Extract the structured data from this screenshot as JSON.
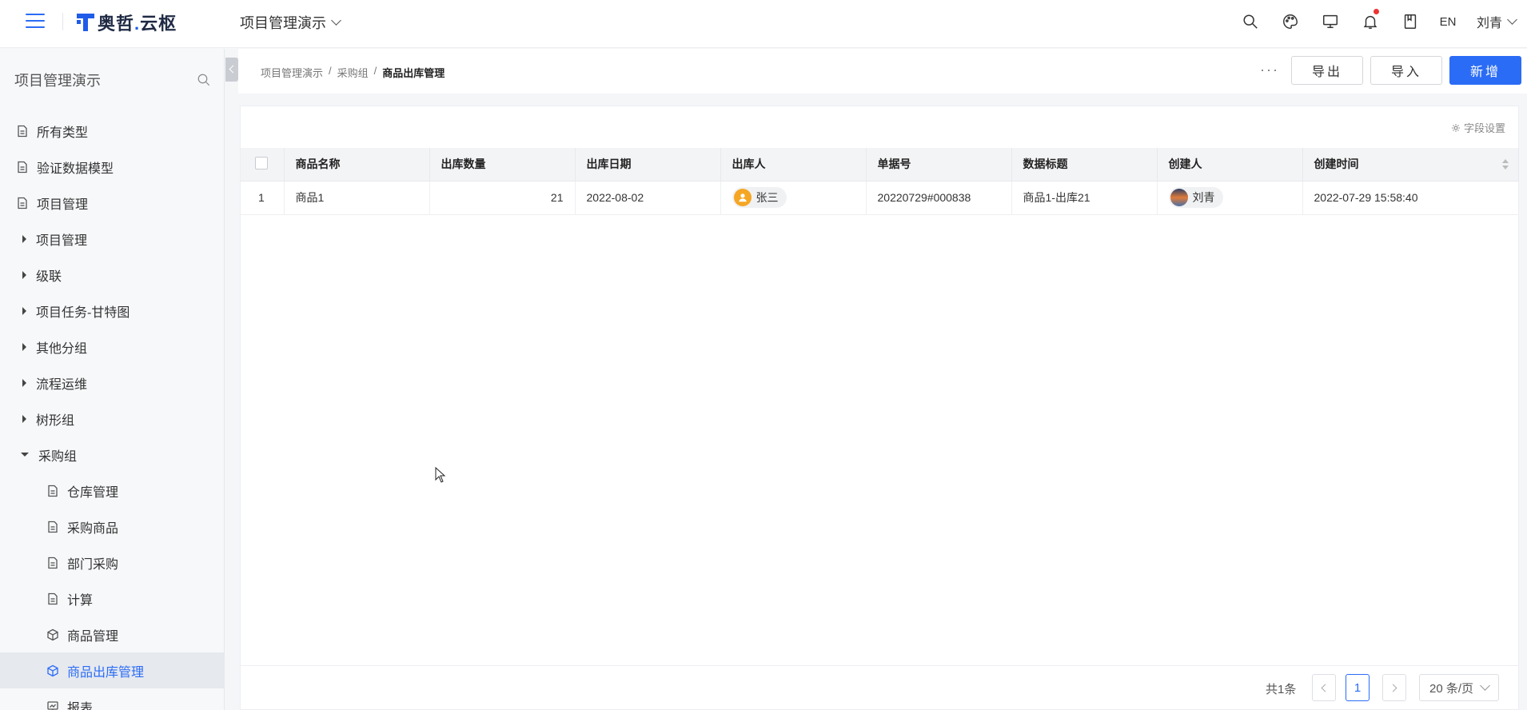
{
  "app": {
    "logo_text_a": "奥哲",
    "logo_dot": ".",
    "logo_text_b": "云枢",
    "project_name": "项目管理演示",
    "lang": "EN",
    "user_name": "刘青"
  },
  "sidebar": {
    "title": "项目管理演示",
    "items": [
      {
        "label": "所有类型"
      },
      {
        "label": "验证数据模型"
      },
      {
        "label": "项目管理"
      },
      {
        "label": "项目管理"
      },
      {
        "label": "级联"
      },
      {
        "label": "项目任务-甘特图"
      },
      {
        "label": "其他分组"
      },
      {
        "label": "流程运维"
      },
      {
        "label": "树形组"
      },
      {
        "label": "采购组"
      },
      {
        "label": "仓库管理"
      },
      {
        "label": "采购商品"
      },
      {
        "label": "部门采购"
      },
      {
        "label": "计算"
      },
      {
        "label": "商品管理"
      },
      {
        "label": "商品出库管理"
      },
      {
        "label": "报表"
      }
    ]
  },
  "breadcrumb": [
    "项目管理演示",
    "/",
    "采购组",
    "/",
    "商品出库管理"
  ],
  "toolbar": {
    "more": "···",
    "export_label": "导出",
    "import_label": "导入",
    "add_label": "新增",
    "field_settings": "字段设置"
  },
  "table": {
    "headers": [
      "商品名称",
      "出库数量",
      "出库日期",
      "出库人",
      "单据号",
      "数据标题",
      "创建人",
      "创建时间"
    ],
    "rows": [
      {
        "index": "1",
        "name": "商品1",
        "qty": "21",
        "date": "2022-08-02",
        "out_person": "张三",
        "doc_no": "20220729#000838",
        "data_title": "商品1-出库21",
        "creator": "刘青",
        "created_at": "2022-07-29 15:58:40"
      }
    ]
  },
  "pagination": {
    "total": "共1条",
    "current_page": "1",
    "page_size": "20 条/页"
  },
  "colors": {
    "accent": "#2b6cf6",
    "notify": "#ee3333"
  }
}
